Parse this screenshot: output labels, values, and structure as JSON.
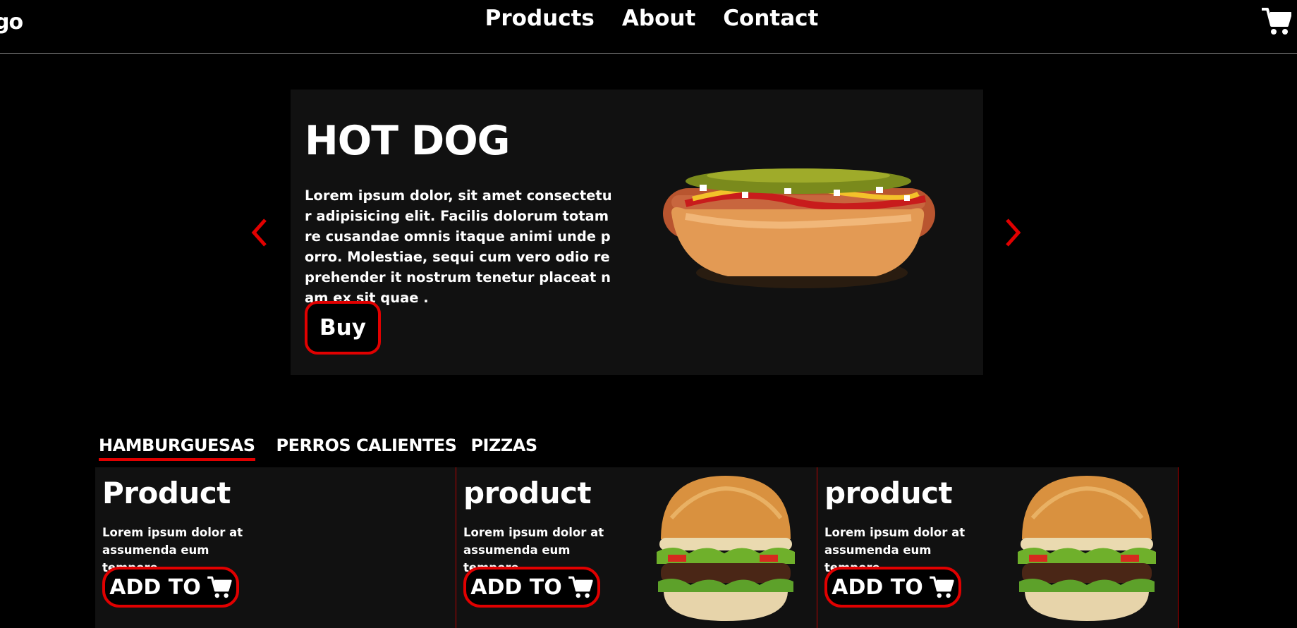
{
  "header": {
    "logo": "go",
    "nav": [
      "Products",
      "About",
      "Contact"
    ]
  },
  "hero": {
    "title": "HOT DOG",
    "description": "Lorem ipsum dolor, sit amet consectetur adipisicing elit. Facilis dolorum totam re cusandae omnis itaque animi unde porro. Molestiae, sequi cum vero odio reprehender it nostrum tenetur placeat nam ex sit quae .",
    "buy_label": "Buy"
  },
  "tabs": [
    "HAMBURGUESAS",
    "PERROS CALIENTES",
    "PIZZAS"
  ],
  "products": [
    {
      "title": "Product",
      "description": "Lorem ipsum dolor at assumenda eum tempore.",
      "button": "ADD TO",
      "has_image": false
    },
    {
      "title": "product",
      "description": "Lorem ipsum dolor at assumenda eum tempore.",
      "button": "ADD TO",
      "has_image": true
    },
    {
      "title": "product",
      "description": "Lorem ipsum dolor at assumenda eum tempore.",
      "button": "ADD TO",
      "has_image": true
    }
  ],
  "colors": {
    "accent": "#e10000",
    "panel": "#111111",
    "background": "#000000"
  },
  "icons": [
    "cart-icon",
    "chevron-left-icon",
    "chevron-right-icon"
  ]
}
